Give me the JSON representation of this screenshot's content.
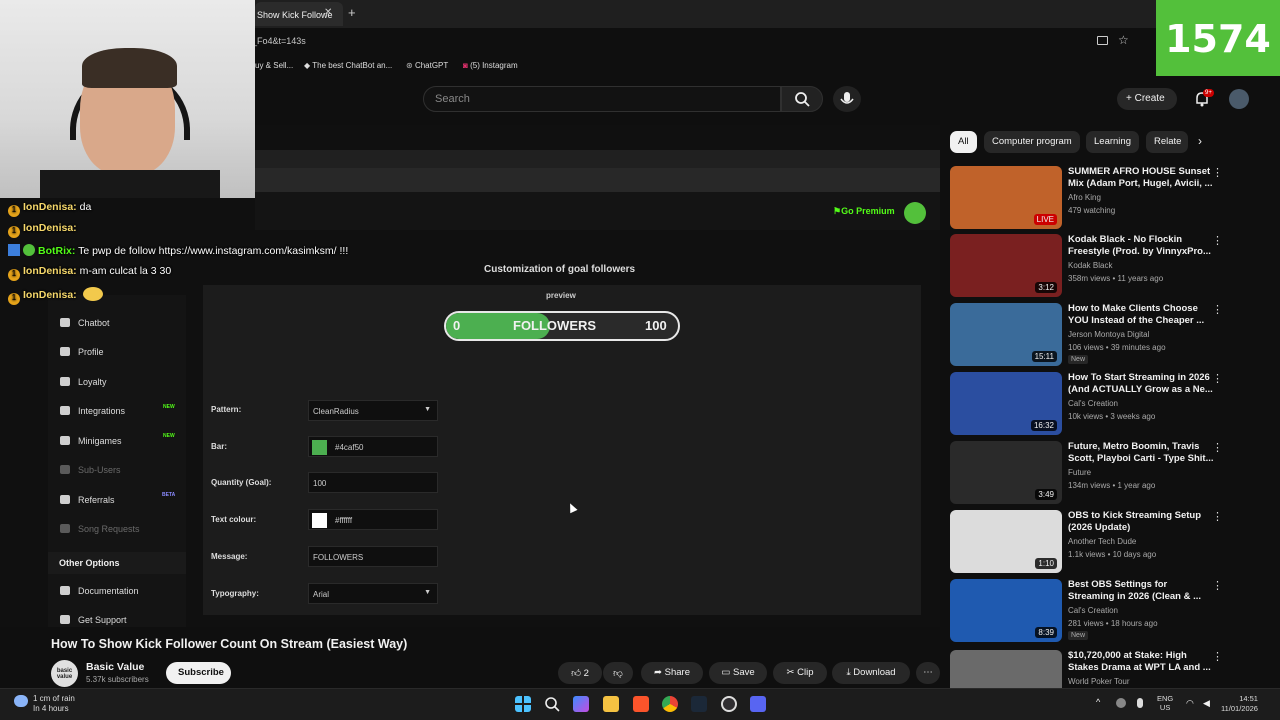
{
  "browser": {
    "active_tab": "Show Kick Followe",
    "url": "_Fo4&t=143s",
    "bookmarks": [
      "uy & Sell...",
      "The best ChatBot an...",
      "ChatGPT",
      "(5) Instagram"
    ]
  },
  "youtube": {
    "search_placeholder": "Search",
    "create_label": "Create",
    "notif_count": "9+"
  },
  "overlay": {
    "counter": "1574"
  },
  "chat": [
    {
      "user": "IonDenisa:",
      "message": "da"
    },
    {
      "user": "IonDenisa:",
      "message": ""
    },
    {
      "user": "BotRix:",
      "message": "Te pwp de follow https://www.instagram.com/kasimksm/ !!!"
    },
    {
      "user": "IonDenisa:",
      "message": "m-am culcat la 3 30"
    },
    {
      "user": "IonDenisa:",
      "message": ""
    }
  ],
  "video_content": {
    "go_premium": "Go Premium",
    "sidebar": [
      {
        "label": "Chatbot",
        "badge": ""
      },
      {
        "label": "Profile",
        "badge": ""
      },
      {
        "label": "Loyalty",
        "badge": ""
      },
      {
        "label": "Integrations",
        "badge": "NEW"
      },
      {
        "label": "Minigames",
        "badge": "NEW"
      },
      {
        "label": "Sub-Users",
        "badge": ""
      },
      {
        "label": "Referrals",
        "badge": "BETA"
      },
      {
        "label": "Song Requests",
        "badge": ""
      }
    ],
    "other_options": "Other Options",
    "sidebar_bottom": [
      "Documentation",
      "Get Support"
    ],
    "heading": "Customization of goal followers",
    "preview_label": "preview",
    "goal": {
      "start": "0",
      "message": "FOLLOWERS",
      "target": "100",
      "progress": 0.45
    },
    "form": {
      "pattern_label": "Pattern:",
      "pattern_value": "CleanRadius",
      "bar_label": "Bar:",
      "bar_value": "#4caf50",
      "bar_color": "#4caf50",
      "quantity_label": "Quantity (Goal):",
      "quantity_value": "100",
      "text_colour_label": "Text colour:",
      "text_colour_value": "#ffffff",
      "text_color": "#ffffff",
      "message_label": "Message:",
      "message_value": "FOLLOWERS",
      "typography_label": "Typography:",
      "typography_value": "Arial"
    }
  },
  "video": {
    "title": "How To Show Kick Follower Count On Stream (Easiest Way)",
    "channel": "Basic Value",
    "channel_avatar_text": "basic value",
    "subscribers": "5.37k subscribers",
    "subscribe_label": "Subscribe",
    "likes": "2",
    "share_label": "Share",
    "save_label": "Save",
    "clip_label": "Clip",
    "download_label": "Download"
  },
  "chips": [
    "All",
    "Computer program",
    "Learning",
    "Relate"
  ],
  "recommendations": [
    {
      "title": "SUMMER AFRO HOUSE Sunset Mix (Adam Port, Hugel, Avicii, ...",
      "channel": "Afro King",
      "meta": "479 watching",
      "duration": "LIVE",
      "badge": "",
      "thumb": "#c0622a"
    },
    {
      "title": "Kodak Black - No Flockin Freestyle (Prod. by VinnyxPro...",
      "channel": "Kodak Black",
      "meta": "358m views • 11 years ago",
      "duration": "3:12",
      "badge": "",
      "thumb": "#7a2020"
    },
    {
      "title": "How to Make Clients Choose YOU Instead of the Cheaper ...",
      "channel": "Jerson Montoya Digital",
      "meta": "106 views • 39 minutes ago",
      "duration": "15:11",
      "badge": "New",
      "thumb": "#3a6b9a"
    },
    {
      "title": "How To Start Streaming in 2026 (And ACTUALLY Grow as a Ne...",
      "channel": "Cal's Creation",
      "meta": "10k views • 3 weeks ago",
      "duration": "16:32",
      "badge": "",
      "thumb": "#2b4ea0"
    },
    {
      "title": "Future, Metro Boomin, Travis Scott, Playboi Carti - Type Shit...",
      "channel": "Future",
      "meta": "134m views • 1 year ago",
      "duration": "3:49",
      "badge": "",
      "thumb": "#2a2a2a"
    },
    {
      "title": "OBS to Kick Streaming Setup (2026 Update)",
      "channel": "Another Tech Dude",
      "meta": "1.1k views • 10 days ago",
      "duration": "1:10",
      "badge": "",
      "thumb": "#dcdcdc"
    },
    {
      "title": "Best OBS Settings for Streaming in 2026 (Clean & ...",
      "channel": "Cal's Creation",
      "meta": "281 views • 18 hours ago",
      "duration": "8:39",
      "badge": "New",
      "thumb": "#1f5ab0"
    },
    {
      "title": "$10,720,000 at Stake: High Stakes Drama at WPT LA and ...",
      "channel": "World Poker Tour",
      "meta": "",
      "duration": "",
      "badge": "",
      "thumb": "#6a6a6a"
    }
  ],
  "taskbar": {
    "weather_line1": "1 cm of rain",
    "weather_line2": "In 4 hours",
    "lang1": "ENG",
    "lang2": "US",
    "time": "14:51",
    "date": "11/01/2026"
  }
}
